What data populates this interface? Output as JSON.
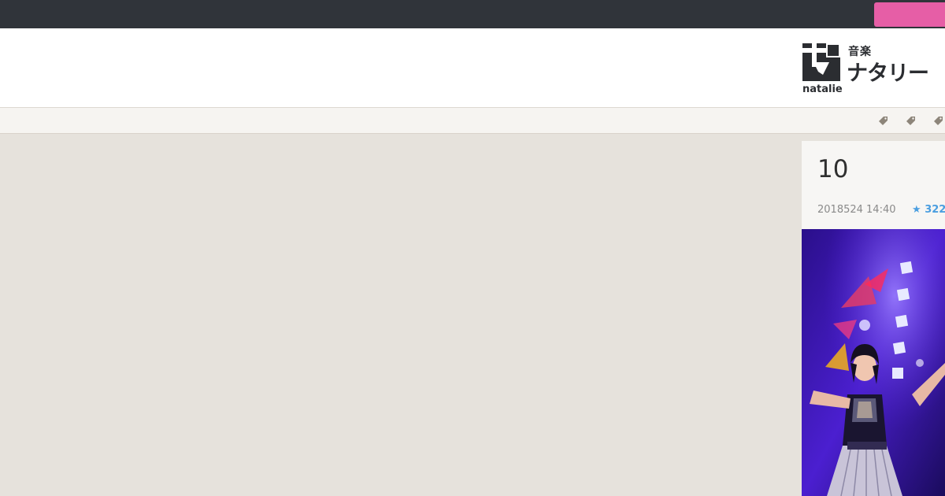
{
  "topbar": {
    "button_label": ""
  },
  "logo": {
    "small_text": "音楽",
    "big_text": "ナタリー",
    "sub_text": "natalie"
  },
  "tag_icons": [
    "tag-icon",
    "tag-icon",
    "tag-icon"
  ],
  "article": {
    "title": "10",
    "date": "2018524 14:40",
    "stars": "322"
  },
  "colors": {
    "topbar": "#30343a",
    "accent_pink": "#e65ea6",
    "background": "#e6e2dc",
    "star_blue": "#4a9ee0"
  }
}
